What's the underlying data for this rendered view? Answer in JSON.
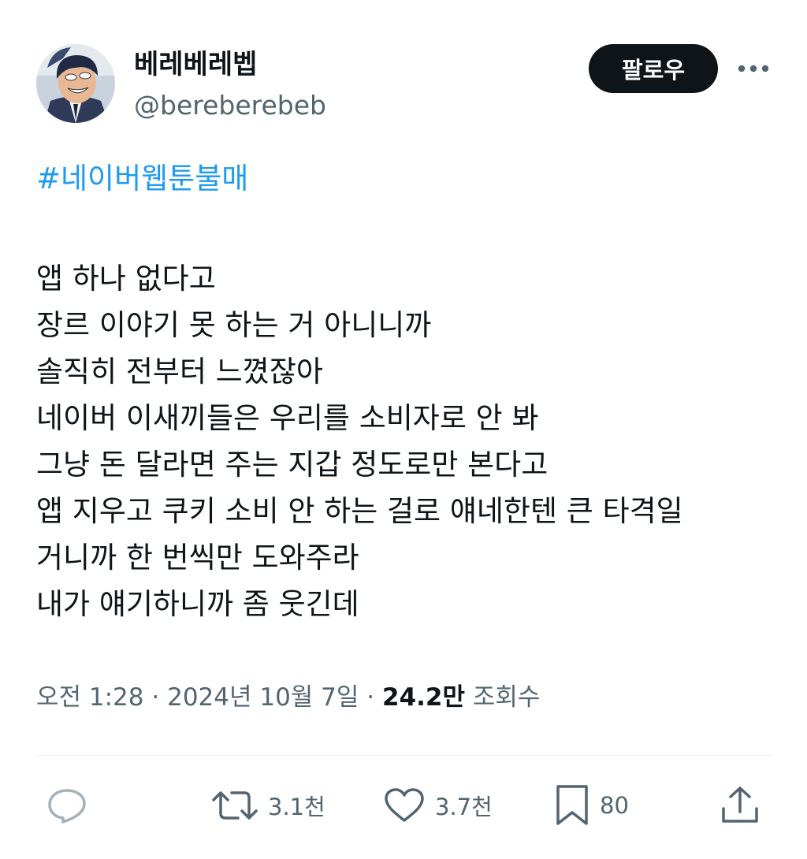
{
  "author": {
    "display_name": "베레베레벱",
    "handle": "@bereberebeb"
  },
  "header": {
    "follow_label": "팔로우",
    "more_icon": "ellipsis-icon"
  },
  "tweet": {
    "hashtag": "#네이버웹툰불매",
    "lines": [
      "앱 하나 없다고",
      "장르 이야기 못 하는 거 아니니까",
      "솔직히 전부터 느꼈잖아",
      "네이버 이새끼들은 우리를 소비자로 안 봐",
      "그냥 돈 달라면 주는 지갑 정도로만 본다고",
      "앱 지우고 쿠키 소비 안 하는 걸로 얘네한텐 큰 타격일",
      "거니까 한 번씩만 도와주라",
      "내가 얘기하니까 좀 웃긴데"
    ]
  },
  "meta": {
    "time": "오전 1:28",
    "separator": "·",
    "date": "2024년 10월 7일",
    "views_count": "24.2만",
    "views_label": "조회수"
  },
  "actions": {
    "reply": {
      "icon": "reply-icon",
      "count": ""
    },
    "retweet": {
      "icon": "retweet-icon",
      "count": "3.1천"
    },
    "like": {
      "icon": "heart-icon",
      "count": "3.7천"
    },
    "bookmark": {
      "icon": "bookmark-icon",
      "count": "80"
    },
    "share": {
      "icon": "share-icon"
    }
  },
  "colors": {
    "text": "#0f1419",
    "muted": "#536471",
    "link": "#1d9bf0",
    "button_bg": "#0f1419",
    "divider": "#eff3f4"
  }
}
